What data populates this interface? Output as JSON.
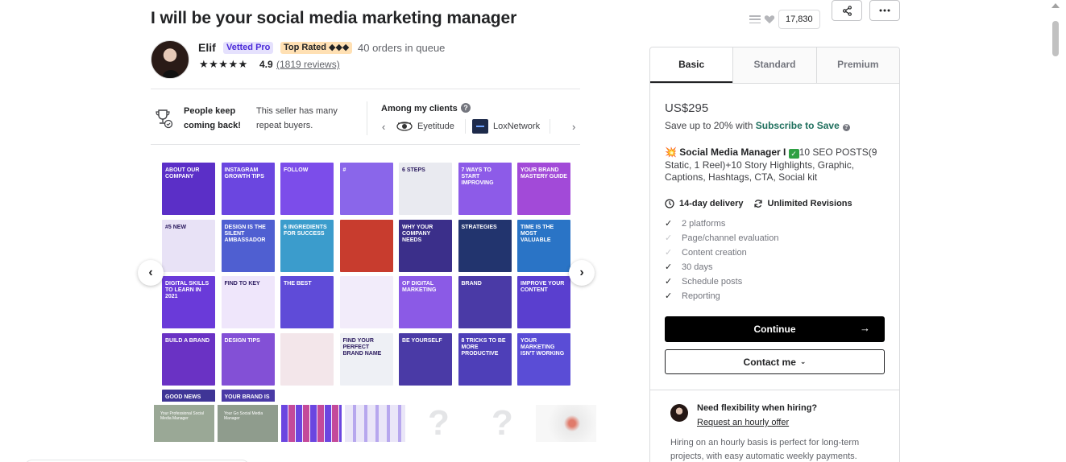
{
  "gig": {
    "title": "I will be your social media marketing manager"
  },
  "actions": {
    "likes_count": "17,830",
    "share_icon": "share-icon",
    "more_icon": "more-icon"
  },
  "seller": {
    "name": "Elif",
    "vetted_badge": "Vetted Pro",
    "top_rated_badge": "Top Rated ◆◆◆",
    "queue": "40 orders in queue",
    "stars": "★★★★★",
    "rating": "4.9",
    "reviews": "(1819 reviews)"
  },
  "trust": {
    "people_title_1": "People keep",
    "people_title_2": "coming back!",
    "repeat_1": "This seller has many",
    "repeat_2": "repeat buyers.",
    "clients_title": "Among my clients",
    "clients": [
      "Eyetitude",
      "LoxNetwork"
    ]
  },
  "gallery": {
    "tiles": [
      {
        "text": "ABOUT OUR company",
        "bg": "#5b2fc7",
        "dark": false
      },
      {
        "text": "Instagram growth tips",
        "bg": "#6b46e0",
        "dark": false
      },
      {
        "text": "Follow",
        "bg": "#7c4dea",
        "dark": false
      },
      {
        "text": "#",
        "bg": "#8a66ea",
        "dark": false
      },
      {
        "text": "6 steps",
        "bg": "#e9eaf0",
        "dark": true
      },
      {
        "text": "7 ways to start improving",
        "bg": "#8d5be8",
        "dark": false
      },
      {
        "text": "Your brand mastery guide",
        "bg": "#a24ad8",
        "dark": false
      },
      {
        "text": "#5 new",
        "bg": "#e8e2f6",
        "dark": true
      },
      {
        "text": "Design is the silent ambassador",
        "bg": "#4f5fd1",
        "dark": false
      },
      {
        "text": "6 ingredients for success",
        "bg": "#3b9ccc",
        "dark": false
      },
      {
        "text": "",
        "bg": "#c83c2e",
        "dark": false
      },
      {
        "text": "Why your company needs",
        "bg": "#3b2f8a",
        "dark": false
      },
      {
        "text": "Strategies",
        "bg": "#22346e",
        "dark": false
      },
      {
        "text": "Time is the most valuable",
        "bg": "#2a74c6",
        "dark": false
      },
      {
        "text": "Digital skills to learn in 2021",
        "bg": "#6a3ad9",
        "dark": false
      },
      {
        "text": "Find to key",
        "bg": "#efe6fb",
        "dark": true
      },
      {
        "text": "The best",
        "bg": "#5f4bd8",
        "dark": false
      },
      {
        "text": "",
        "bg": "#f2ecfa",
        "dark": true
      },
      {
        "text": "Of digital marketing",
        "bg": "#8b5ae6",
        "dark": false
      },
      {
        "text": "Brand",
        "bg": "#4a3aa6",
        "dark": false
      },
      {
        "text": "Improve your content",
        "bg": "#5a3fcf",
        "dark": false
      },
      {
        "text": "Build a brand",
        "bg": "#6a32c4",
        "dark": false
      },
      {
        "text": "Design tips",
        "bg": "#8350d6",
        "dark": false
      },
      {
        "text": "",
        "bg": "#f3e6ea",
        "dark": true
      },
      {
        "text": "Find your perfect brand name",
        "bg": "#eef0f5",
        "dark": true
      },
      {
        "text": "Be yourself",
        "bg": "#4a3aa6",
        "dark": false
      },
      {
        "text": "8 tricks to be more productive",
        "bg": "#4e3fb8",
        "dark": false
      },
      {
        "text": "Your marketing isn't working",
        "bg": "#5a4dd6",
        "dark": false
      },
      {
        "text": "Good news",
        "bg": "#3f3596",
        "dark": false
      },
      {
        "text": "Your brand is",
        "bg": "#4a3aa6",
        "dark": false
      }
    ],
    "thumbs": [
      {
        "kind": "photo",
        "text": "Your Professional Social Media Manager",
        "bg": "#9aa896"
      },
      {
        "kind": "photo",
        "text": "Your Go Social Media Manager",
        "bg": "#8f9c8d"
      },
      {
        "kind": "grid",
        "text": "",
        "bg": "#7a5ad6"
      },
      {
        "kind": "grid2",
        "text": "",
        "bg": "#e8e2f6"
      },
      {
        "kind": "q",
        "text": "?",
        "bg": "#ffffff"
      },
      {
        "kind": "q",
        "text": "?",
        "bg": "#ffffff"
      },
      {
        "kind": "blur",
        "text": "",
        "bg": "#eeeeee"
      }
    ]
  },
  "package": {
    "tabs": [
      "Basic",
      "Standard",
      "Premium"
    ],
    "price": "US$295",
    "save_prefix": "Save up to 20% with ",
    "save_link": "Subscribe to Save",
    "desc_title": "Social Media Manager I",
    "desc_rest": "10 SEO POSTS(9 Static, 1 Reel)+10 Story Highlights, Graphic, Captions, Hashtags, CTA, Social kit",
    "delivery": "14-day delivery",
    "revisions": "Unlimited Revisions",
    "features": [
      {
        "label": "2 platforms",
        "included": true
      },
      {
        "label": "Page/channel evaluation",
        "included": false
      },
      {
        "label": "Content creation",
        "included": false
      },
      {
        "label": "30 days",
        "included": true
      },
      {
        "label": "Schedule posts",
        "included": true
      },
      {
        "label": "Reporting",
        "included": true
      }
    ],
    "continue_label": "Continue",
    "contact_label": "Contact me"
  },
  "hourly": {
    "title": "Need flexibility when hiring?",
    "link": "Request an hourly offer",
    "text": "Hiring on an hourly basis is perfect for long-term projects, with easy automatic weekly payments."
  }
}
